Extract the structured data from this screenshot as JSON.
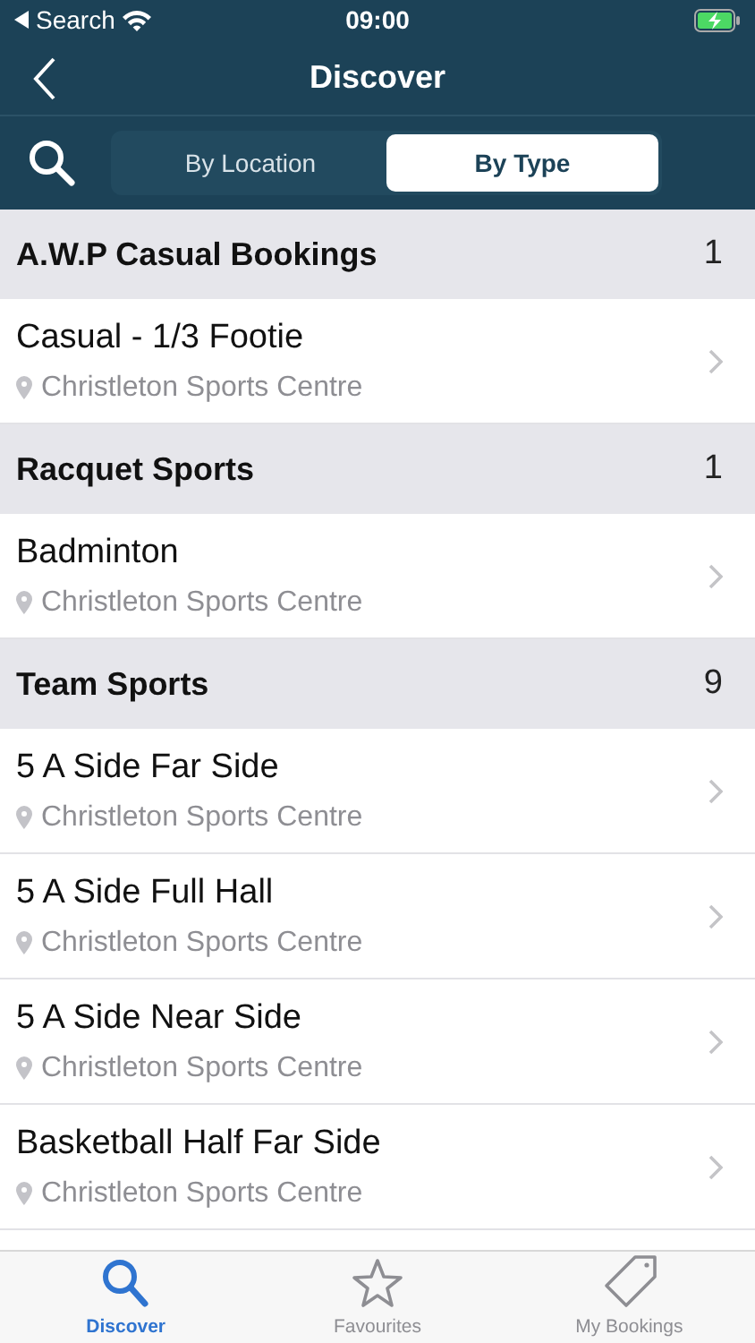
{
  "status_bar": {
    "back_label": "Search",
    "time": "09:00"
  },
  "nav": {
    "title": "Discover"
  },
  "segments": [
    {
      "label": "By Location",
      "selected": false
    },
    {
      "label": "By Type",
      "selected": true
    }
  ],
  "sections": [
    {
      "title": "A.W.P Casual Bookings",
      "count": "1",
      "items": [
        {
          "name": "Casual - 1/3 Footie",
          "location": "Christleton Sports Centre"
        }
      ]
    },
    {
      "title": "Racquet Sports",
      "count": "1",
      "items": [
        {
          "name": "Badminton",
          "location": "Christleton Sports Centre"
        }
      ]
    },
    {
      "title": "Team Sports",
      "count": "9",
      "items": [
        {
          "name": "5 A Side Far Side",
          "location": "Christleton Sports Centre"
        },
        {
          "name": "5 A Side Full Hall",
          "location": "Christleton Sports Centre"
        },
        {
          "name": "5 A Side Near Side",
          "location": "Christleton Sports Centre"
        },
        {
          "name": "Basketball Half Far Side",
          "location": "Christleton Sports Centre"
        }
      ]
    }
  ],
  "tab_bar": [
    {
      "kind": "search",
      "label": "Discover",
      "selected": true
    },
    {
      "kind": "star",
      "label": "Favourites",
      "selected": false
    },
    {
      "kind": "tag",
      "label": "My Bookings",
      "selected": false
    }
  ]
}
